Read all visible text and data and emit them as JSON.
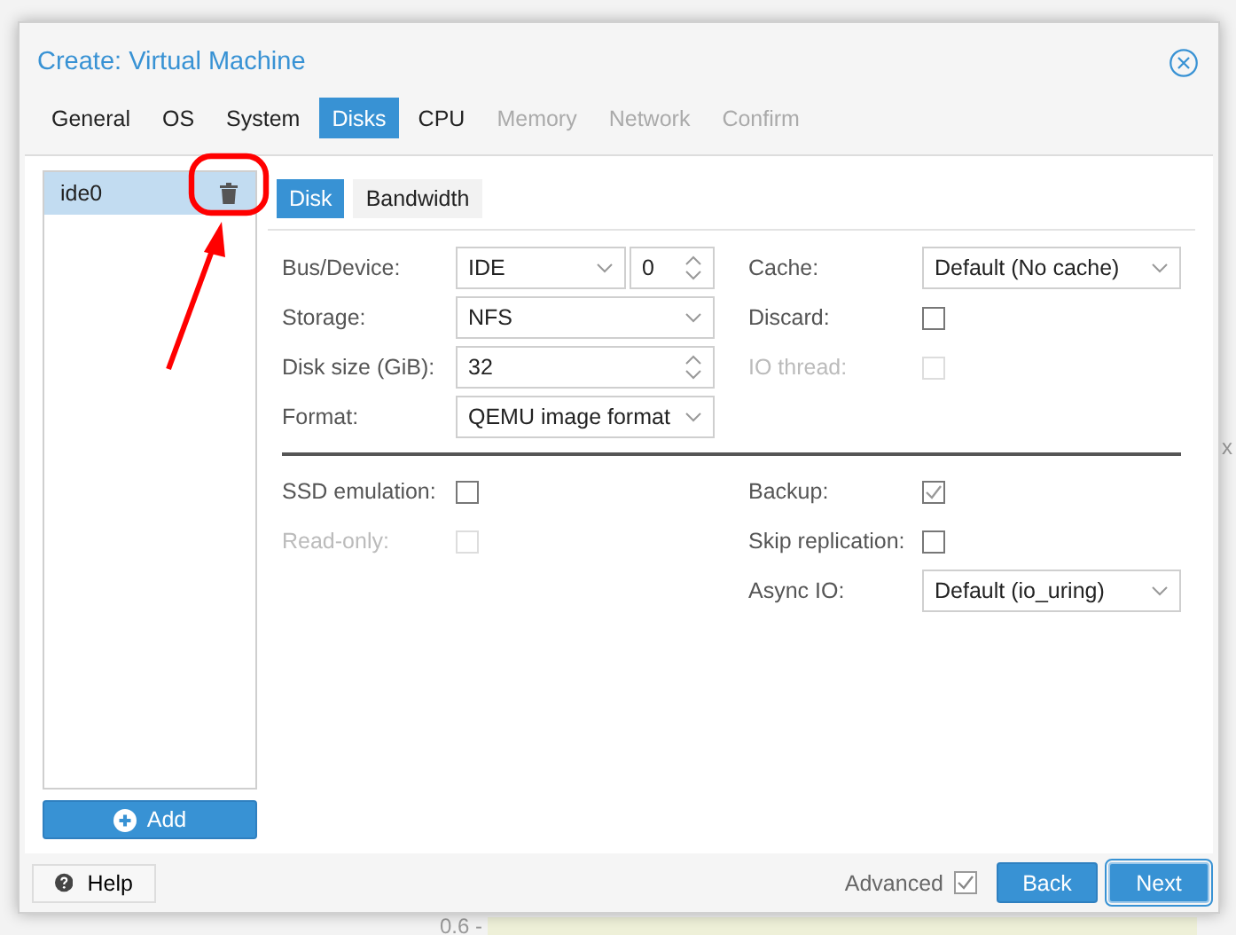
{
  "background": {
    "texts": [
      {
        "text": "x",
        "kind": "side2"
      },
      {
        "text": "0.6 -",
        "kind": "axis"
      }
    ]
  },
  "dialog": {
    "title": "Create: Virtual Machine"
  },
  "tabs": [
    {
      "label": "General",
      "selected": false,
      "disabled": false
    },
    {
      "label": "OS",
      "selected": false,
      "disabled": false
    },
    {
      "label": "System",
      "selected": false,
      "disabled": false
    },
    {
      "label": "Disks",
      "selected": true,
      "disabled": false
    },
    {
      "label": "CPU",
      "selected": false,
      "disabled": false
    },
    {
      "label": "Memory",
      "selected": false,
      "disabled": true
    },
    {
      "label": "Network",
      "selected": false,
      "disabled": true
    },
    {
      "label": "Confirm",
      "selected": false,
      "disabled": true
    }
  ],
  "disk_list": {
    "items": [
      {
        "label": "ide0",
        "selected": true
      }
    ],
    "add_button": "Add"
  },
  "subtabs": [
    {
      "label": "Disk",
      "selected": true
    },
    {
      "label": "Bandwidth",
      "selected": false
    }
  ],
  "left_top": [
    {
      "label": "Bus/Device:",
      "kind": "bus",
      "value": "IDE",
      "device": "0"
    },
    {
      "label": "Storage:",
      "kind": "select",
      "value": "NFS"
    },
    {
      "label": "Disk size (GiB):",
      "kind": "spinner",
      "value": "32"
    },
    {
      "label": "Format:",
      "kind": "select",
      "value": "QEMU image format"
    }
  ],
  "right_top": [
    {
      "label": "Cache:",
      "kind": "select",
      "value": "Default (No cache)"
    },
    {
      "label": "Discard:",
      "kind": "checkbox",
      "checked": false,
      "disabled": false
    },
    {
      "label": "IO thread:",
      "kind": "checkbox",
      "checked": false,
      "disabled": true
    }
  ],
  "left_bottom": [
    {
      "label": "SSD emulation:",
      "kind": "checkbox",
      "checked": false,
      "disabled": false
    },
    {
      "label": "Read-only:",
      "kind": "checkbox",
      "checked": false,
      "disabled": true
    }
  ],
  "right_bottom": [
    {
      "label": "Backup:",
      "kind": "checkbox",
      "checked": true,
      "disabled": false
    },
    {
      "label": "Skip replication:",
      "kind": "checkbox",
      "checked": false,
      "disabled": false
    },
    {
      "label": "Async IO:",
      "kind": "select",
      "value": "Default (io_uring)"
    }
  ],
  "footer": {
    "help": "Help",
    "advanced": {
      "label": "Advanced",
      "checked": true
    },
    "buttons": [
      {
        "label": "Back",
        "focused": false
      },
      {
        "label": "Next",
        "focused": true
      }
    ]
  }
}
